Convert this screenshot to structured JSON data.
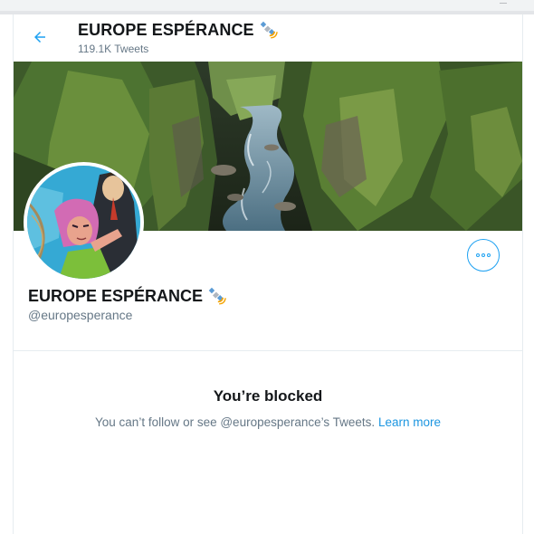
{
  "header": {
    "name": "EUROPE ESPÉRANCE",
    "tweet_count": "119.1K Tweets",
    "back_icon": "arrow-left-icon",
    "badge_icon": "satellite-icon"
  },
  "profile": {
    "name": "EUROPE ESPÉRANCE",
    "handle": "@europesperance",
    "more_icon": "more-dots-icon"
  },
  "blocked": {
    "title": "You’re blocked",
    "message": "You can’t follow or see @europesperance’s Tweets.",
    "link": "Learn more"
  },
  "colors": {
    "accent": "#1da1f2",
    "text": "#14171a",
    "muted": "#657786",
    "border": "#e6ecf0"
  }
}
